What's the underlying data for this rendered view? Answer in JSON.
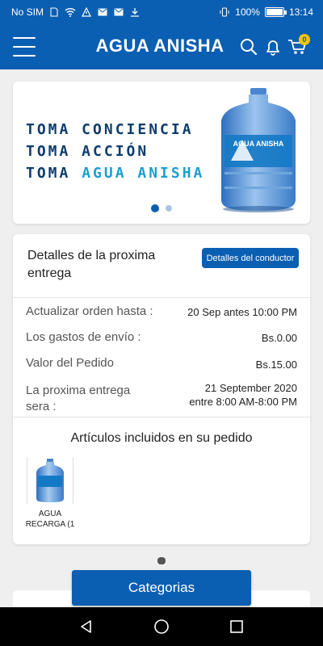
{
  "status_bar": {
    "carrier": "No SIM",
    "battery": "100%",
    "battery_level": 1.0,
    "time": "13:14"
  },
  "app_bar": {
    "title": "AGUA ANISHA",
    "cart_count": "0",
    "icons": [
      "menu-icon",
      "search-icon",
      "bell-icon",
      "cart-icon"
    ]
  },
  "banner": {
    "line1": "TOMA CONCIENCIA",
    "line2": "TOMA ACCIÓN",
    "line3_prefix": "TOMA ",
    "line3_accent": "AGUA ANISHA",
    "bottle_label": "AGUA ANISHA",
    "slides": 2,
    "active_slide": 0
  },
  "order": {
    "title": "Detalles de la proxima entrega",
    "driver_button": "Detalles del conductor",
    "rows": [
      {
        "label": "Actualizar orden hasta :",
        "value": "20 Sep antes 10:00 PM"
      },
      {
        "label": "Los gastos de envío :",
        "value": "Bs.0.00"
      },
      {
        "label": "Valor del Pedido",
        "value": "Bs.15.00"
      }
    ],
    "delivery": {
      "label": "La proxima entrega sera :",
      "value_line1": "21 September 2020",
      "value_line2": "entre 8:00 AM-8:00 PM"
    },
    "items_title": "Artículos incluidos en su pedido",
    "items": [
      {
        "name_line1": "AGUA",
        "name_line2": "RECARGA (1"
      }
    ]
  },
  "categories_button": "Categorias",
  "colors": {
    "primary": "#0b5fb2",
    "accent": "#1b9fd1",
    "banner_text": "#0f3d6e",
    "background": "#efefef"
  }
}
